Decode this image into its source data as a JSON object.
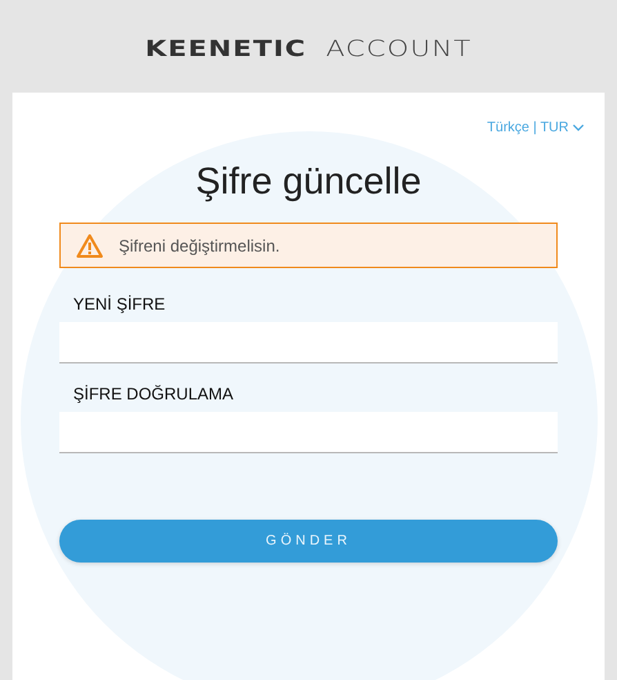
{
  "logo": {
    "brand": "KEENETIC",
    "product": "ACCOUNT"
  },
  "language": {
    "label": "Türkçe | TUR"
  },
  "title": "Şifre güncelle",
  "alert": {
    "kind": "warning",
    "message": "Şifreni değiştirmelisin."
  },
  "fields": [
    {
      "label": "YENİ ŞİFRE"
    },
    {
      "label": "ŞİFRE DOĞRULAMA"
    }
  ],
  "submit": "GÖNDER"
}
